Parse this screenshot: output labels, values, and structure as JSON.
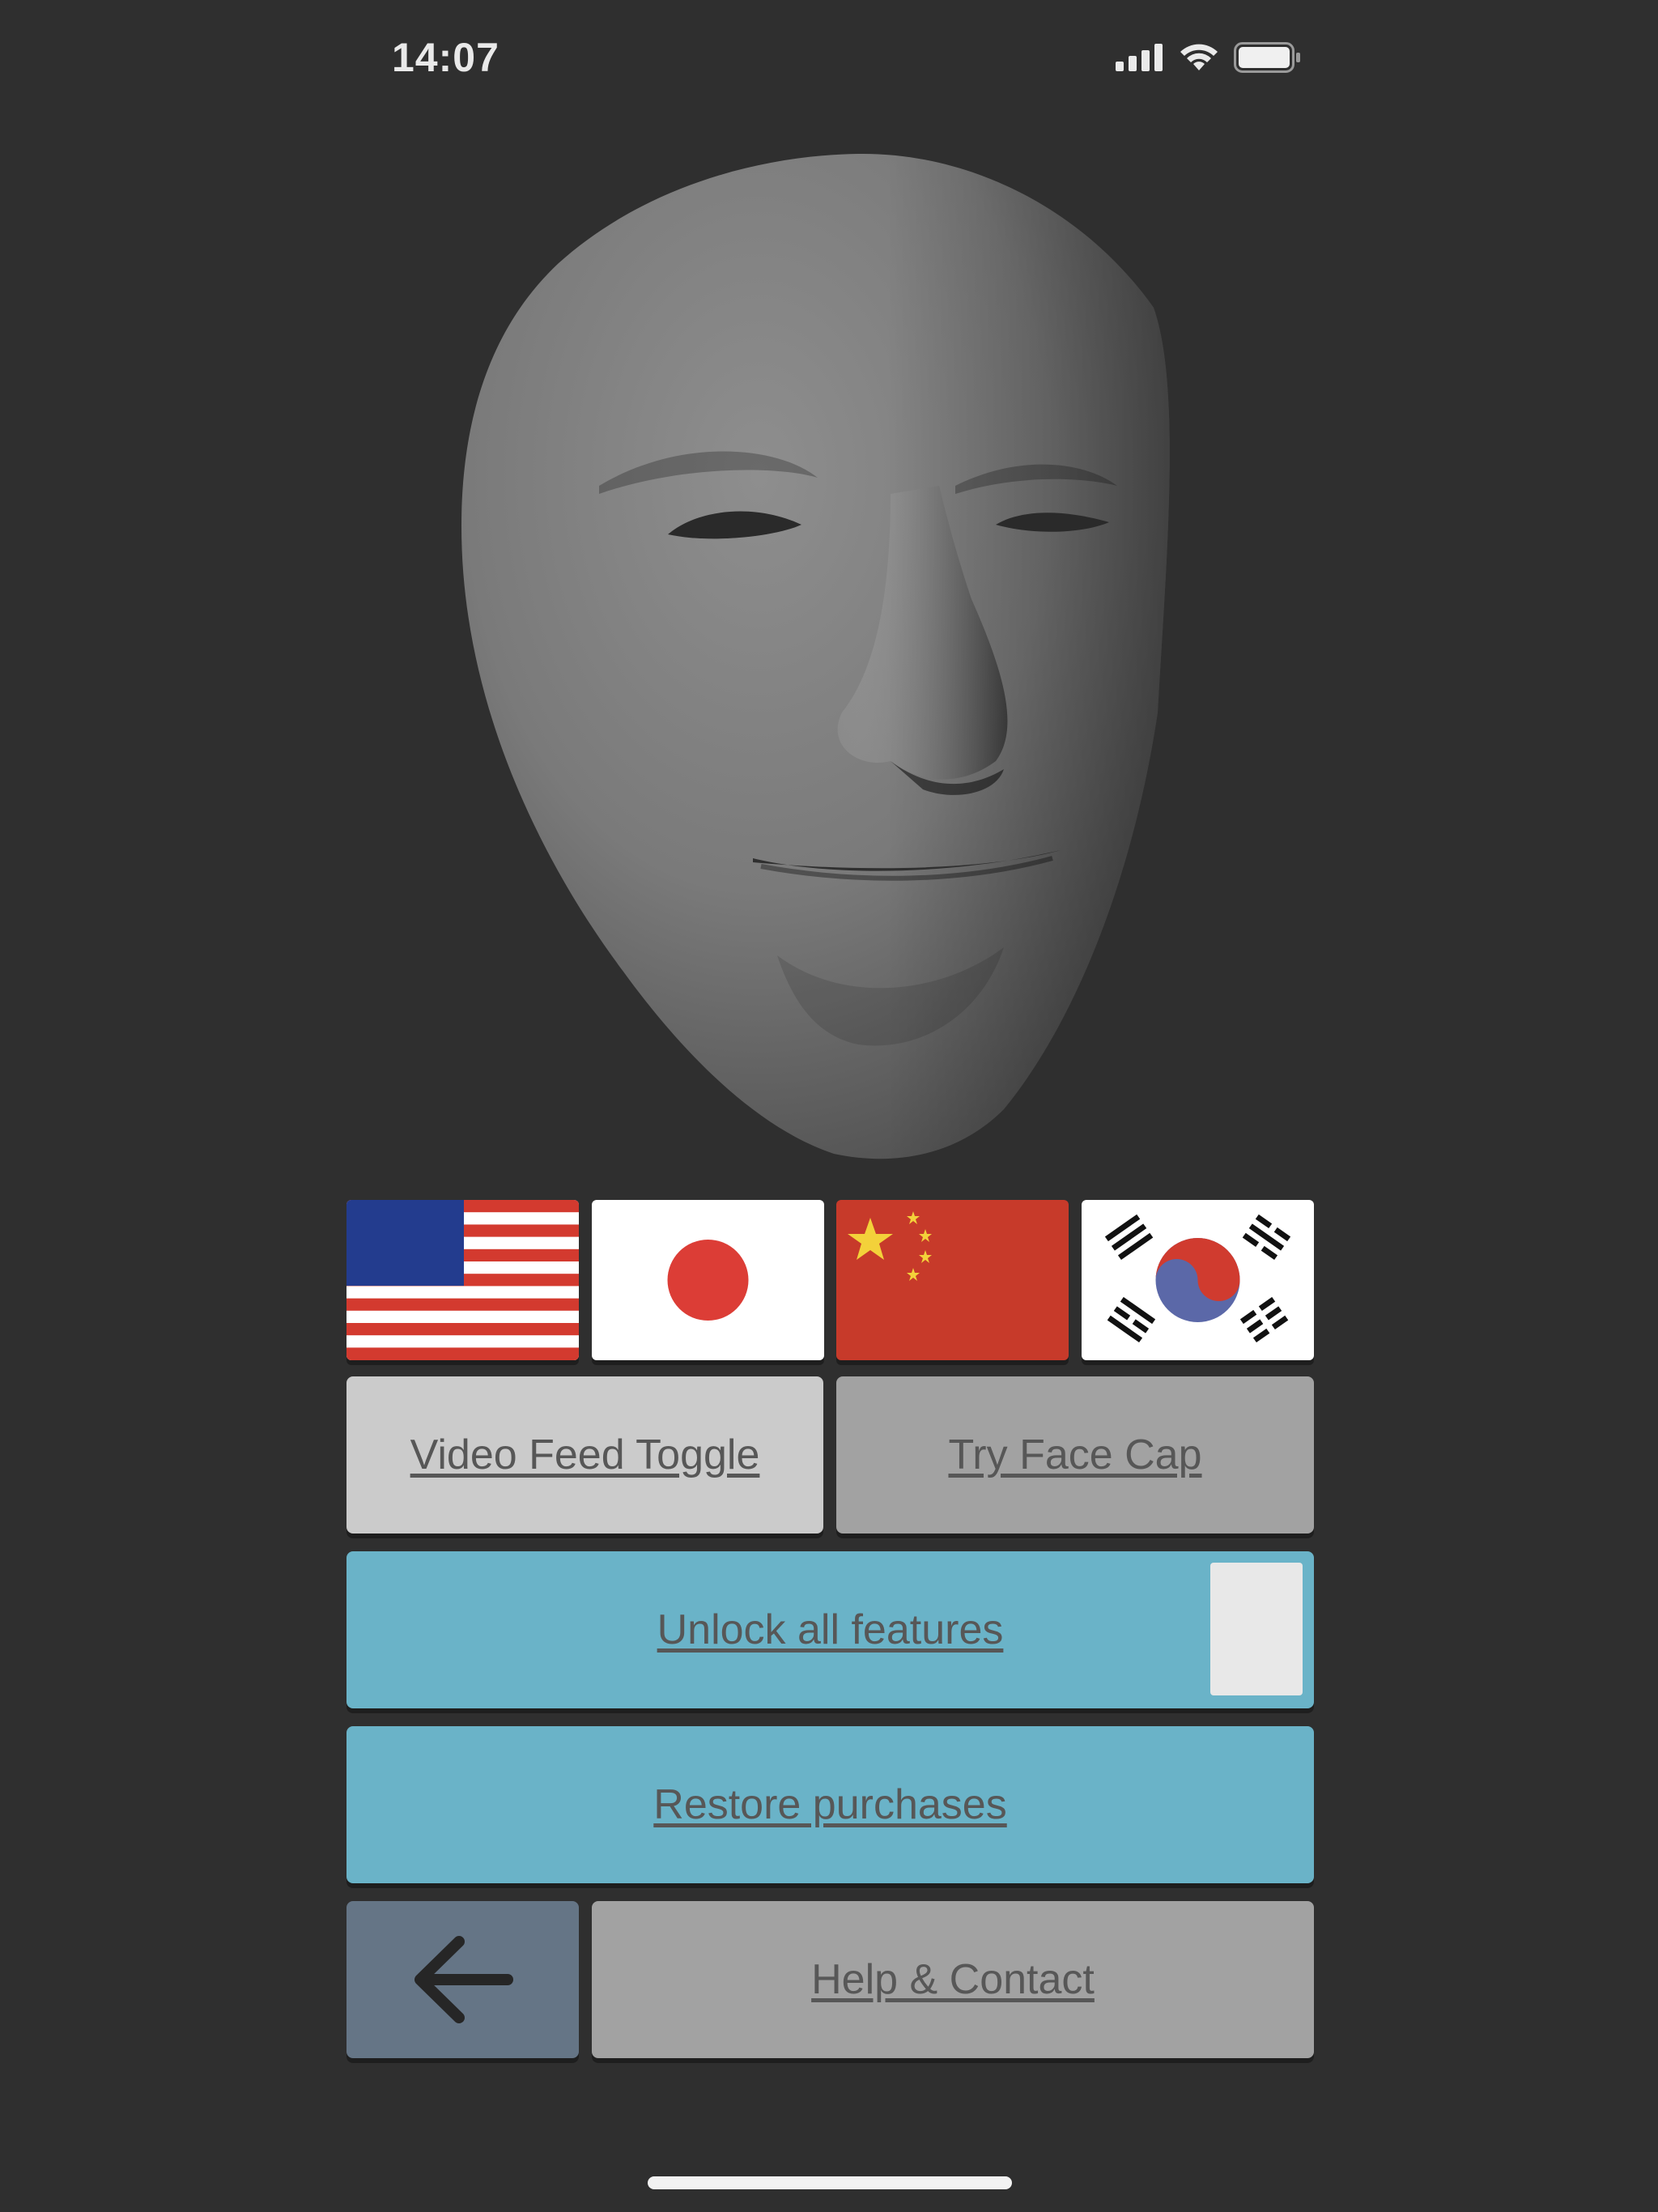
{
  "status_bar": {
    "time": "14:07",
    "icons": [
      "cellular-signal-icon",
      "wifi-icon",
      "battery-icon"
    ]
  },
  "viewport": {
    "model": "face-mesh-3d"
  },
  "flags": [
    {
      "name": "flag-usa",
      "country": "United States"
    },
    {
      "name": "flag-japan",
      "country": "Japan"
    },
    {
      "name": "flag-china",
      "country": "China"
    },
    {
      "name": "flag-south-korea",
      "country": "South Korea"
    }
  ],
  "buttons": {
    "video_feed_toggle": "Video Feed Toggle",
    "try_face_cap": "Try Face Cap",
    "unlock_all_features": "Unlock all features",
    "restore_purchases": "Restore purchases",
    "back": "back-arrow-icon",
    "help_contact": "Help & Contact"
  },
  "colors": {
    "background": "#2f2f2f",
    "teal_button": "#6ab3c8",
    "light_button": "#cbcbcb",
    "gray_button": "#a2a2a2",
    "back_button": "#657586",
    "label_text": "#575757"
  }
}
